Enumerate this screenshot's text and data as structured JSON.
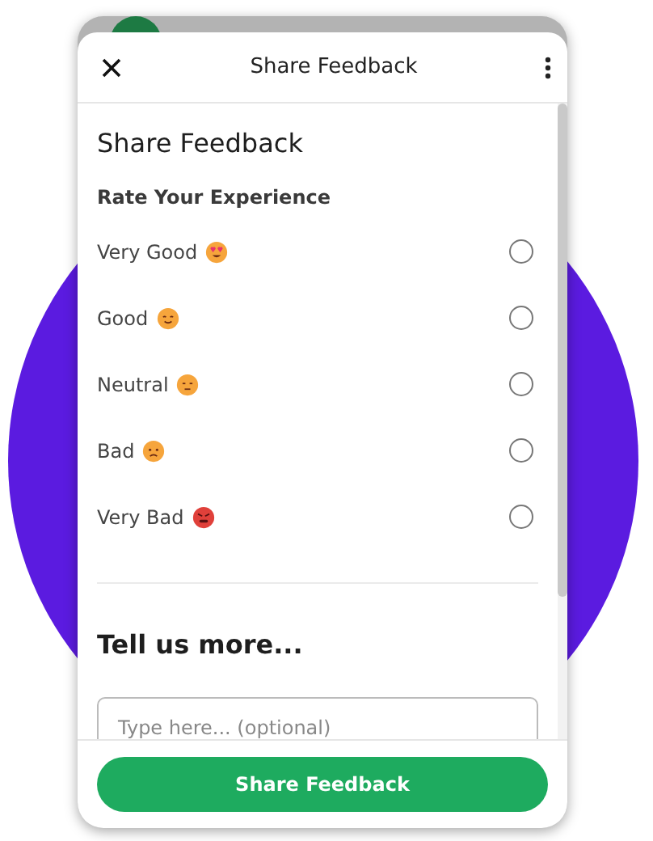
{
  "header": {
    "title": "Share Feedback"
  },
  "form": {
    "heading": "Share Feedback",
    "rating_label": "Rate Your Experience",
    "options": [
      {
        "label": "Very Good",
        "kind": "love",
        "selected": false
      },
      {
        "label": "Good",
        "kind": "smile",
        "selected": false
      },
      {
        "label": "Neutral",
        "kind": "neutral",
        "selected": false
      },
      {
        "label": "Bad",
        "kind": "sad",
        "selected": false
      },
      {
        "label": "Very Bad",
        "kind": "angry",
        "selected": false
      }
    ],
    "more_heading": "Tell us more...",
    "comment": {
      "placeholder": "Type here... (optional)"
    }
  },
  "footer": {
    "button": "Share Feedback"
  }
}
